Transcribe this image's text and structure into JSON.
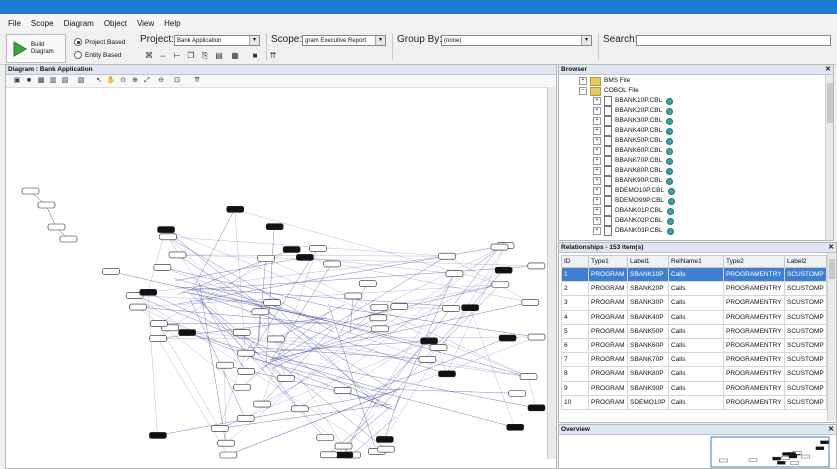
{
  "menu": [
    "File",
    "Scope",
    "Diagram",
    "Object",
    "View",
    "Help"
  ],
  "toolbar": {
    "build_label": "Build\nDiagram",
    "radio_project": "Project Based",
    "radio_entity": "Entity Based",
    "project_label": "Project:",
    "project_value": "Bank Application",
    "scope_label": "Scope:",
    "scope_value": "gram Executive Report",
    "groupby_label": "Group By:",
    "groupby_value": "(none)",
    "search_label": "Search:",
    "search_value": ""
  },
  "diagram": {
    "title": "Diagram : Bank Application"
  },
  "browser": {
    "title": "Browser",
    "folders": [
      "BMS File",
      "COBOL File"
    ],
    "files": [
      "BBANK10P.CBL",
      "BBANK20P.CBL",
      "BBANK30P.CBL",
      "BBANK40P.CBL",
      "BBANK50P.CBL",
      "BBANK60P.CBL",
      "BBANK70P.CBL",
      "BBANK80P.CBL",
      "BBANK90P.CBL",
      "BDEMO10P.CBL",
      "BDEMO99P.CBL",
      "DBANK01P.CBL",
      "DBANK02P.CBL",
      "DBANK03P.CBL"
    ]
  },
  "relationships": {
    "title": "Relationships - 153 item(s)",
    "columns": [
      "ID",
      "Type1",
      "Label1",
      "RelName1",
      "Type2",
      "Label2"
    ],
    "rows": [
      [
        "1",
        "PROGRAM",
        "SBANK10P",
        "Calls",
        "PROGRAMENTRY",
        "SCUSTOMP"
      ],
      [
        "2",
        "PROGRAM",
        "SBANK20P",
        "Calls",
        "PROGRAMENTRY",
        "SCUSTOMP"
      ],
      [
        "3",
        "PROGRAM",
        "SBANK30P",
        "Calls",
        "PROGRAMENTRY",
        "SCUSTOMP"
      ],
      [
        "4",
        "PROGRAM",
        "SBANK40P",
        "Calls",
        "PROGRAMENTRY",
        "SCUSTOMP"
      ],
      [
        "5",
        "PROGRAM",
        "SBANK50P",
        "Calls",
        "PROGRAMENTRY",
        "SCUSTOMP"
      ],
      [
        "6",
        "PROGRAM",
        "SBANK60P",
        "Calls",
        "PROGRAMENTRY",
        "SCUSTOMP"
      ],
      [
        "7",
        "PROGRAM",
        "SBANK70P",
        "Calls",
        "PROGRAMENTRY",
        "SCUSTOMP"
      ],
      [
        "8",
        "PROGRAM",
        "SBANK80P",
        "Calls",
        "PROGRAMENTRY",
        "SCUSTOMP"
      ],
      [
        "9",
        "PROGRAM",
        "SBANK90P",
        "Calls",
        "PROGRAMENTRY",
        "SCUSTOMP"
      ],
      [
        "10",
        "PROGRAM",
        "SDEMO10P",
        "Calls",
        "PROGRAMENTRY",
        "SCUSTOMP"
      ]
    ]
  },
  "overview": {
    "title": "Overview"
  },
  "colors": {
    "titlebar": "#1e7bd2",
    "selected_row": "#3e7fd1",
    "node_dark": "#111111",
    "edge": "#4a4aa8"
  }
}
